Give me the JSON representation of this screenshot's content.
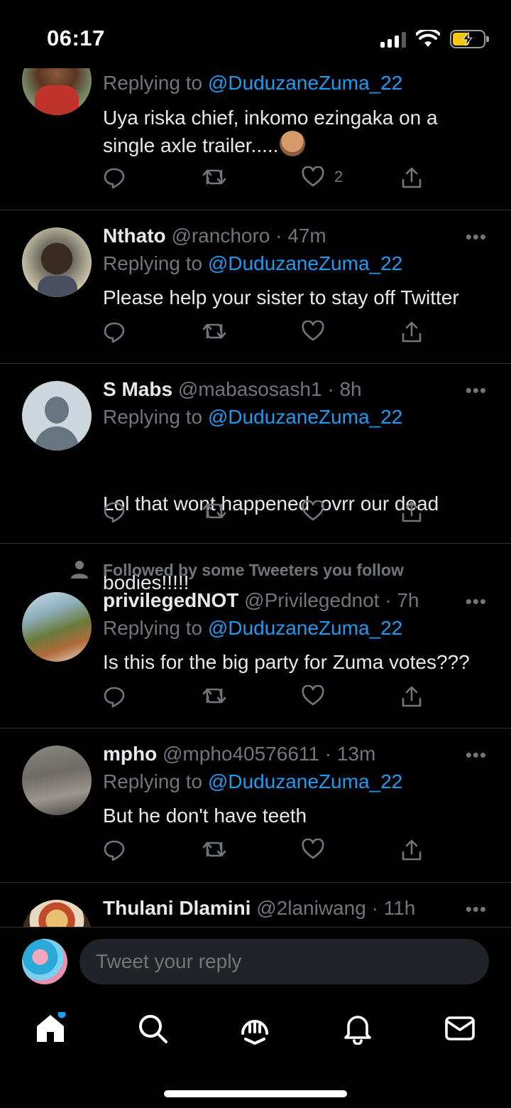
{
  "status_bar": {
    "time": "06:17"
  },
  "tweets": [
    {
      "name": "",
      "handle": "",
      "time": "",
      "replying_to_label": "Replying to",
      "replying_to": "@DuduzaneZuma_22",
      "text_lines": [
        "Uya riska chief, inkomo ezingaka on a",
        "single axle trailer....."
      ],
      "likes": "2"
    },
    {
      "name": "Nthato",
      "handle": "@ranchoro",
      "time": "· 47m",
      "replying_to_label": "Replying to",
      "replying_to": "@DuduzaneZuma_22",
      "text_lines": [
        "Please help your sister to stay off Twitter"
      ],
      "likes": ""
    },
    {
      "name": "S Mabs",
      "handle": "@mabasosash1",
      "time": "· 8h",
      "replying_to_label": "Replying to",
      "replying_to": "@DuduzaneZuma_22",
      "text_lines": [
        "Lol that wont happened  ovrr our dead",
        "bodies!!!!!"
      ],
      "likes": ""
    },
    {
      "social_context": "Followed by some Tweeters you follow",
      "name": "privilegedNOT",
      "handle": "@Privilegednot",
      "time": "· 7h",
      "replying_to_label": "Replying to",
      "replying_to": "@DuduzaneZuma_22",
      "text_lines": [
        "Is this for the big party for Zuma votes???"
      ],
      "likes": ""
    },
    {
      "name": "mpho",
      "handle": "@mpho40576611",
      "time": "· 13m",
      "replying_to_label": "Replying to",
      "replying_to": "@DuduzaneZuma_22",
      "text_lines": [
        "But he don't have teeth"
      ],
      "likes": ""
    },
    {
      "name": "Thulani Dlamini",
      "handle": "@2laniwang",
      "time": "· 11h"
    }
  ],
  "composer": {
    "placeholder": "Tweet your reply"
  },
  "tabbar": {
    "items": [
      "home-icon",
      "search-icon",
      "spaces-icon",
      "notifications-icon",
      "messages-icon"
    ]
  },
  "colors": {
    "background": "#000000",
    "text": "#e7e9ea",
    "secondary": "#71767b",
    "accent": "#1d9bf0",
    "divider": "#2f3336",
    "battery": "#f5c518"
  }
}
